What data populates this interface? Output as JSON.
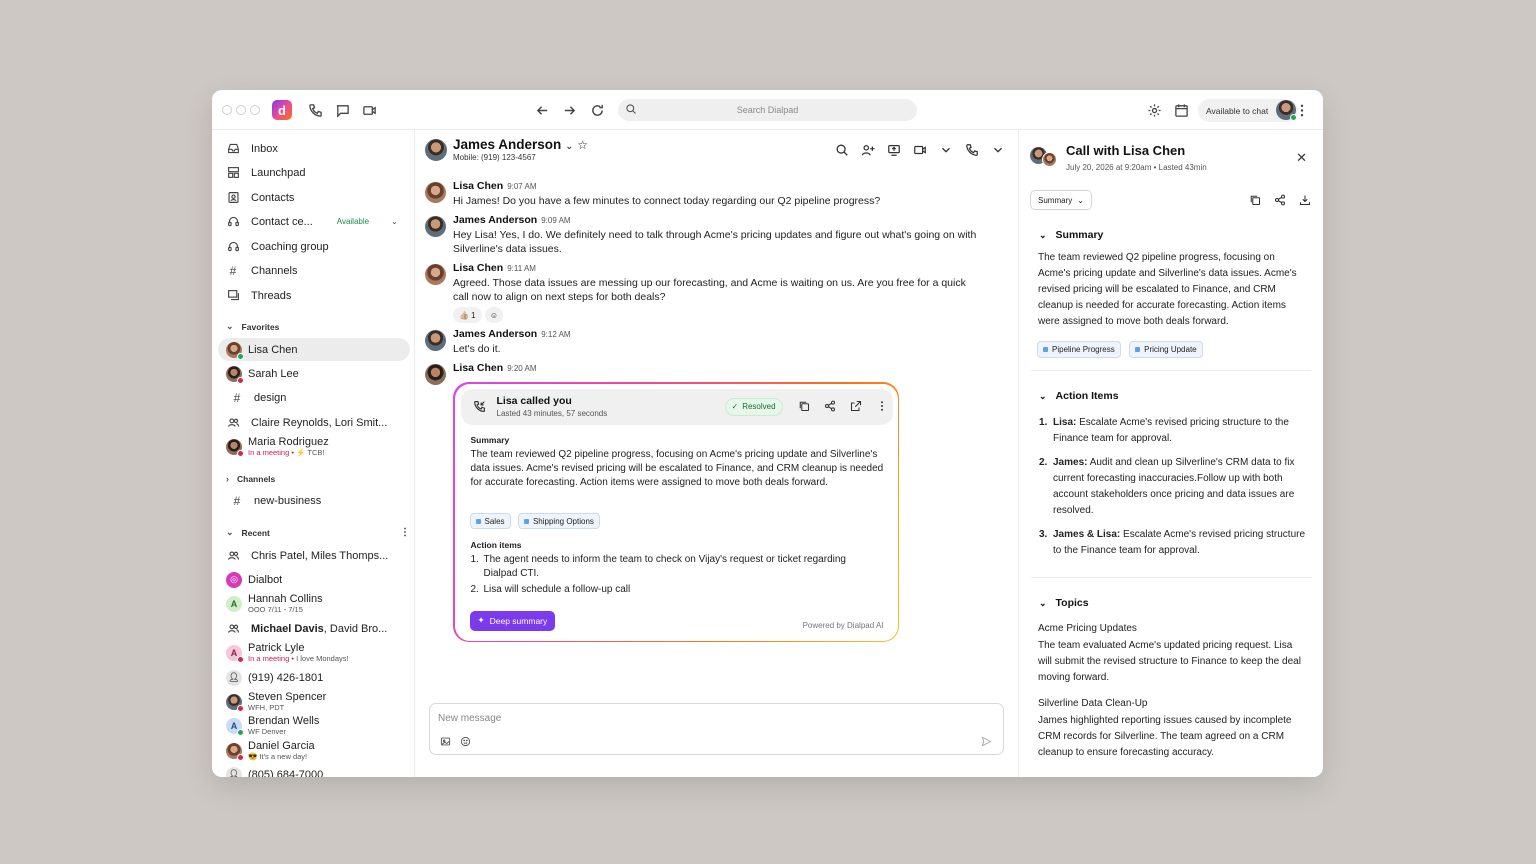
{
  "titlebar": {
    "app_logo": "d",
    "search_placeholder": "Search Dialpad",
    "status_label": "Available to chat",
    "icons": [
      "phone-icon",
      "message-icon",
      "video-icon",
      "back-icon",
      "forward-icon",
      "refresh-icon",
      "search-icon",
      "gear-icon",
      "calendar-icon",
      "more-icon"
    ]
  },
  "sidebar": {
    "nav": [
      {
        "label": "Inbox",
        "icon": "inbox-icon"
      },
      {
        "label": "Launchpad",
        "icon": "launchpad-icon"
      },
      {
        "label": "Contacts",
        "icon": "contacts-icon"
      },
      {
        "label": "Contact ce...",
        "icon": "headset-icon",
        "tag": "Available"
      },
      {
        "label": "Coaching group",
        "icon": "coaching-icon"
      },
      {
        "label": "Channels",
        "icon": "hash-icon"
      },
      {
        "label": "Threads",
        "icon": "threads-icon"
      }
    ],
    "favorites_label": "Favorites",
    "favorites": [
      {
        "label": "Lisa Chen"
      },
      {
        "label": "Sarah Lee"
      },
      {
        "label": "design"
      },
      {
        "label": "Claire Reynolds, Lori Smit..."
      },
      {
        "label": "Maria Rodriguez",
        "sub_status": "In a meeting",
        "sub_note": " • ⚡ TCB!"
      }
    ],
    "channels_label": "Channels",
    "channels": [
      {
        "label": "new-business"
      }
    ],
    "recent_label": "Recent",
    "recent": [
      {
        "label": "Chris Patel, Miles Thomps..."
      },
      {
        "label": "Dialbot"
      },
      {
        "label": "Hannah Collins",
        "sub": "OOO 7/11 - 7/15",
        "letter": "A"
      },
      {
        "label_bold": "Michael Davis",
        "label_rest": ", David Bro..."
      },
      {
        "label": "Patrick Lyle",
        "sub_status": "In a meeting",
        "sub_note": " • I love Mondays!",
        "letter": "A"
      },
      {
        "label": "(919) 426-1801"
      },
      {
        "label": "Steven Spencer",
        "sub": "WFH, PDT"
      },
      {
        "label": "Brendan Wells",
        "sub": "WF Denver",
        "letter": "A"
      },
      {
        "label": "Daniel Garcia",
        "sub": "😎 It's a new day!"
      },
      {
        "label": "(805) 684-7000"
      }
    ]
  },
  "chat": {
    "contact_name": "James Anderson",
    "contact_sub": "Mobile: (919) 123-4567",
    "messages": [
      {
        "author": "Lisa Chen",
        "time": "9:07 AM",
        "text": "Hi James! Do you have a few minutes to connect today regarding our Q2 pipeline progress?"
      },
      {
        "author": "James Anderson",
        "time": "9:09 AM",
        "text": "Hey Lisa! Yes, I do. We definitely need to talk through Acme's pricing updates and figure out what's going on with Silverline's data issues."
      },
      {
        "author": "Lisa Chen",
        "time": "9:11 AM",
        "text": "Agreed. Those data issues are messing up our forecasting, and Acme is waiting on us. Are you free for a quick call now to align on next steps for both deals?",
        "reaction": "👍🏼 1"
      },
      {
        "author": "James Anderson",
        "time": "9:12 AM",
        "text": "Let's do it."
      },
      {
        "author": "Lisa Chen",
        "time": "9:20 AM",
        "text": ""
      }
    ],
    "call_card": {
      "title": "Lisa called you",
      "subtitle": "Lasted 43 minutes, 57 seconds",
      "status": "Resolved",
      "summary_label": "Summary",
      "summary": "The team reviewed Q2 pipeline progress, focusing on Acme's pricing update and Silverline's data issues. Acme's revised pricing will be escalated to Finance, and CRM cleanup is needed for accurate forecasting. Action items were assigned to move both deals forward.",
      "tags": [
        "Sales",
        "Shipping Options"
      ],
      "action_label": "Action items",
      "actions": [
        "The agent needs to inform the team to check on Vijay's request or ticket regarding Dialpad CTI.",
        "Lisa will schedule a follow-up call"
      ],
      "deep_summary_label": "Deep summary",
      "powered_by": "Powered by Dialpad AI"
    },
    "composer_placeholder": "New message"
  },
  "right_panel": {
    "title": "Call with Lisa Chen",
    "subtitle": "July 20, 2026 at 9:20am • Lasted 43min",
    "dropdown": "Summary",
    "summary_heading": "Summary",
    "summary_text": "The team reviewed Q2 pipeline progress, focusing on Acme's pricing update and Silverline's data issues. Acme's revised pricing will be escalated to Finance, and CRM cleanup is needed for accurate forecasting. Action items were assigned to move both deals forward.",
    "tags": [
      "Pipeline Progress",
      "Pricing Update"
    ],
    "action_heading": "Action Items",
    "actions": [
      {
        "who": "Lisa:",
        "text": " Escalate Acme's revised pricing structure to the Finance team for approval."
      },
      {
        "who": "James:",
        "text": " Audit and clean up Silverline's CRM data to fix current forecasting inaccuracies.Follow up with both account stakeholders once pricing and data issues are resolved."
      },
      {
        "who": "James & Lisa:",
        "text": " Escalate Acme's revised pricing structure to the Finance team for approval."
      }
    ],
    "topics_heading": "Topics",
    "topics": [
      {
        "title": "Acme Pricing Updates",
        "text": "The team evaluated Acme's updated pricing request. Lisa will submit the revised structure to Finance to keep the deal moving forward."
      },
      {
        "title": "Silverline Data Clean-Up",
        "text": "James highlighted reporting issues caused by incomplete CRM records for Silverline. The team agreed on a CRM cleanup to ensure forecasting accuracy."
      }
    ]
  },
  "colors": {
    "accent": "#7c3aed",
    "available_green": "#22a55a",
    "meeting_red": "#c81e56"
  }
}
